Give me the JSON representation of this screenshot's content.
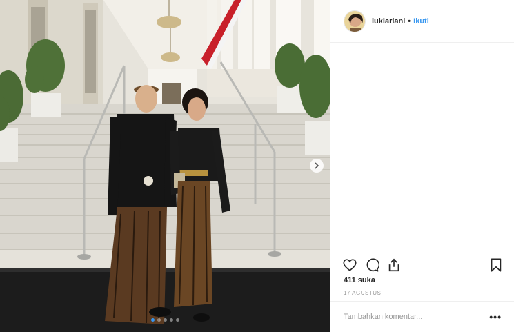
{
  "post": {
    "username": "lukiariani",
    "separator": "•",
    "follow_label": "Ikuti",
    "likes_text": "411 suka",
    "date_text": "17 AGUSTUS",
    "comment_placeholder": "Tambahkan komentar...",
    "more_label": "•••",
    "carousel_total": 5,
    "carousel_active": 1
  },
  "icons": {
    "like": "heart-icon",
    "comment": "comment-icon",
    "share": "share-icon",
    "save": "bookmark-icon",
    "next": "chevron-right-icon"
  },
  "colors": {
    "accent": "#3897f0",
    "text": "#262626",
    "muted": "#999999",
    "border": "#efefef"
  }
}
